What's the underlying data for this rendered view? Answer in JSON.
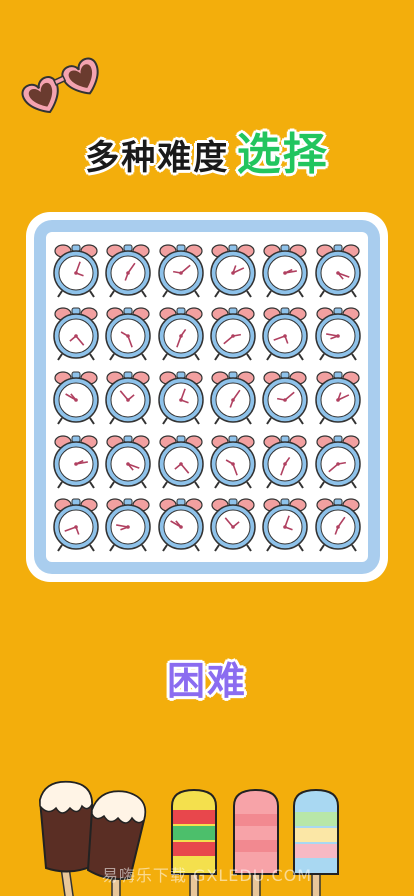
{
  "title": {
    "part1": "多种难度",
    "part2": "选择"
  },
  "difficulty_label": "困难",
  "grid": {
    "rows": 5,
    "cols": 6,
    "item_icon": "alarm-clock-icon"
  },
  "watermark": "易嗨乐下载 GXLEDU.COM",
  "colors": {
    "background": "#F3AE0C",
    "accent_green": "#22C55E",
    "difficulty_purple": "#8B6CF0",
    "frame_blue": "#A9CDEE",
    "clock_blue": "#8EC2EA",
    "bell_pink": "#F2A0A0"
  }
}
